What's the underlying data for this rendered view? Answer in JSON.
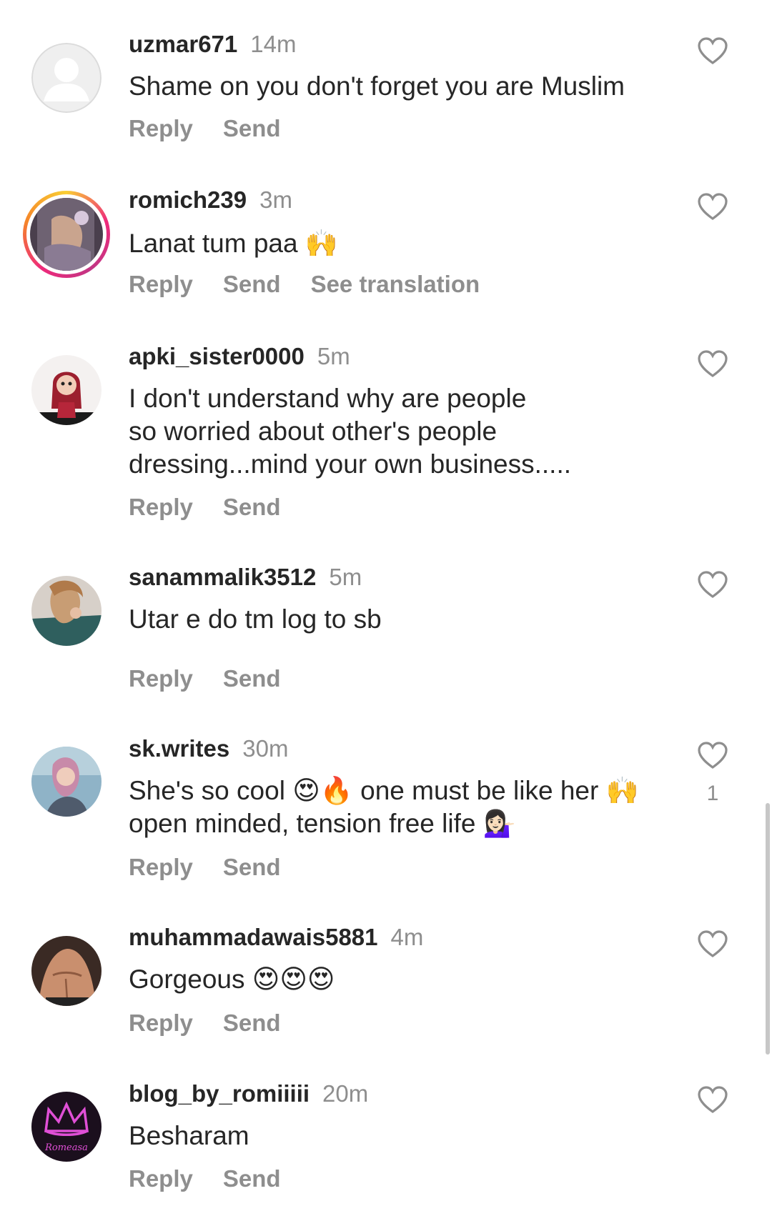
{
  "comments": [
    {
      "username": "uzmar671",
      "time": "14m",
      "text": "Shame on you don't forget you are Muslim",
      "actions": [
        "Reply",
        "Send"
      ],
      "avatar_icon": "default-user-icon"
    },
    {
      "username": "romich239",
      "time": "3m",
      "text": "Lanat tum paa 🙌",
      "actions": [
        "Reply",
        "Send",
        "See translation"
      ],
      "avatar_icon": "photo-avatar",
      "story_ring": true
    },
    {
      "username": "apki_sister0000",
      "time": "5m",
      "text": "I don't understand why are people\nso worried about other's people\ndressing...mind your own business.....",
      "actions": [
        "Reply",
        "Send"
      ],
      "avatar_icon": "cartoon-avatar"
    },
    {
      "username": "sanammalik3512",
      "time": "5m",
      "text": "Utar e do tm log to sb",
      "actions": [
        "Reply",
        "Send"
      ],
      "avatar_icon": "photo-avatar"
    },
    {
      "username": "sk.writes",
      "time": "30m",
      "text": "She's so cool 😍🔥 one must be like her 🙌\nopen minded, tension free life 💁🏻‍♀️",
      "actions": [
        "Reply",
        "Send"
      ],
      "avatar_icon": "photo-avatar",
      "likes": "1"
    },
    {
      "username": "muhammadawais5881",
      "time": "4m",
      "text": "Gorgeous 😍😍😍",
      "actions": [
        "Reply",
        "Send"
      ],
      "avatar_icon": "photo-avatar"
    },
    {
      "username": "blog_by_romiiiii",
      "time": "20m",
      "text": "Besharam",
      "actions": [
        "Reply",
        "Send"
      ],
      "avatar_icon": "crown-logo-avatar",
      "avatar_text": "Romeasa"
    }
  ],
  "colors": {
    "text": "#262626",
    "secondary": "#8e8e8e",
    "heart_stroke": "#8e8e8e",
    "story_ring": [
      "#f9ce34",
      "#ee2a7b",
      "#c13584"
    ]
  }
}
